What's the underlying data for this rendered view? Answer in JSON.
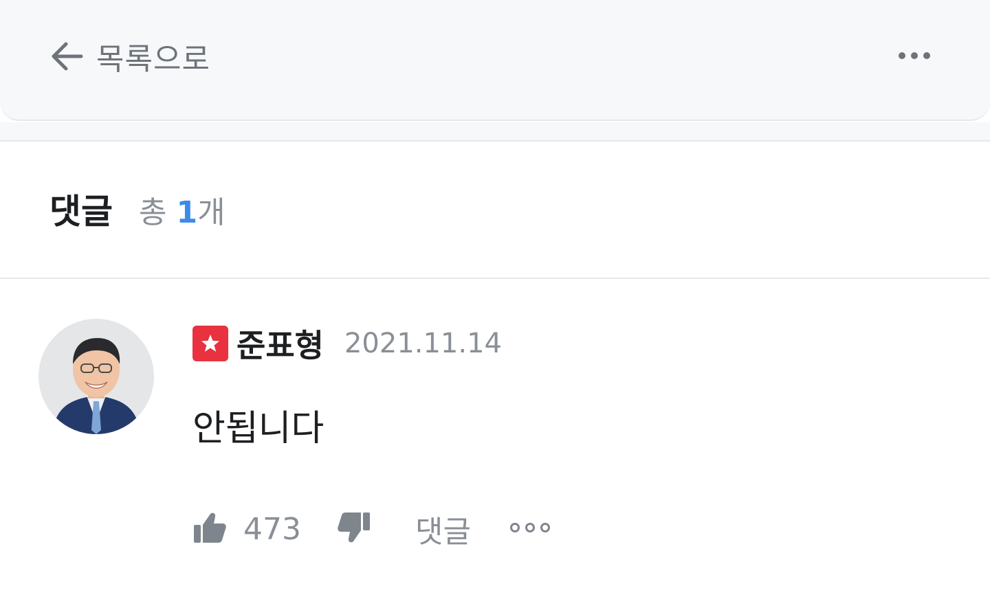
{
  "nav": {
    "back_label": "목록으로",
    "back_icon": "arrow-left-icon",
    "more_icon": "more-horizontal-icon"
  },
  "comments": {
    "title": "댓글",
    "count_prefix": "총 ",
    "count": "1",
    "count_suffix": "개"
  },
  "comment": {
    "author": "준표형",
    "badge_icon": "star-badge-icon",
    "date": "2021.11.14",
    "body": "안됩니다",
    "likes": "473",
    "reply_label": "댓글",
    "like_icon": "thumbs-up-icon",
    "dislike_icon": "thumbs-down-icon",
    "more_icon": "more-dots-outline-icon"
  },
  "colors": {
    "accent": "#3d8be8",
    "badge": "#e8323f",
    "muted_text": "#8a8f96",
    "primary_text": "#1d1f22",
    "top_bar_bg": "#f7f8fa"
  }
}
